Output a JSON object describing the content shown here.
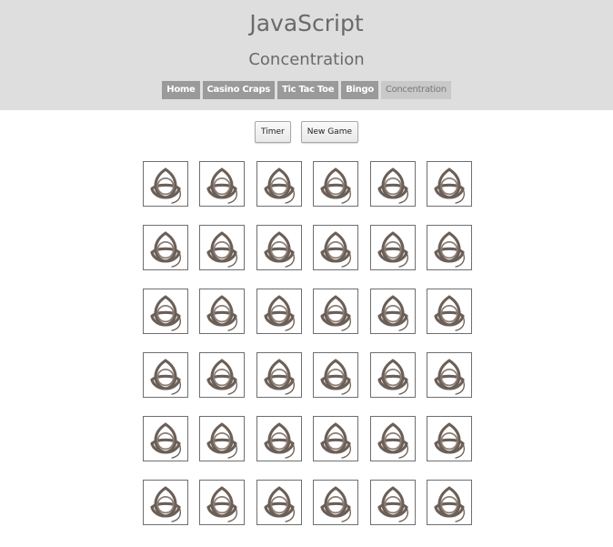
{
  "header": {
    "site_title": "JavaScript",
    "page_subtitle": "Concentration"
  },
  "nav": {
    "items": [
      {
        "label": "Home",
        "active": false
      },
      {
        "label": "Casino Craps",
        "active": false
      },
      {
        "label": "Tic Tac Toe",
        "active": false
      },
      {
        "label": "Bingo",
        "active": false
      },
      {
        "label": "Concentration",
        "active": true
      }
    ]
  },
  "controls": {
    "timer_label": "Timer",
    "new_game_label": "New Game"
  },
  "board": {
    "rows": 6,
    "columns": 6,
    "card_back_icon": "triquetra-icon",
    "card_back_color": "#6b5f57"
  }
}
